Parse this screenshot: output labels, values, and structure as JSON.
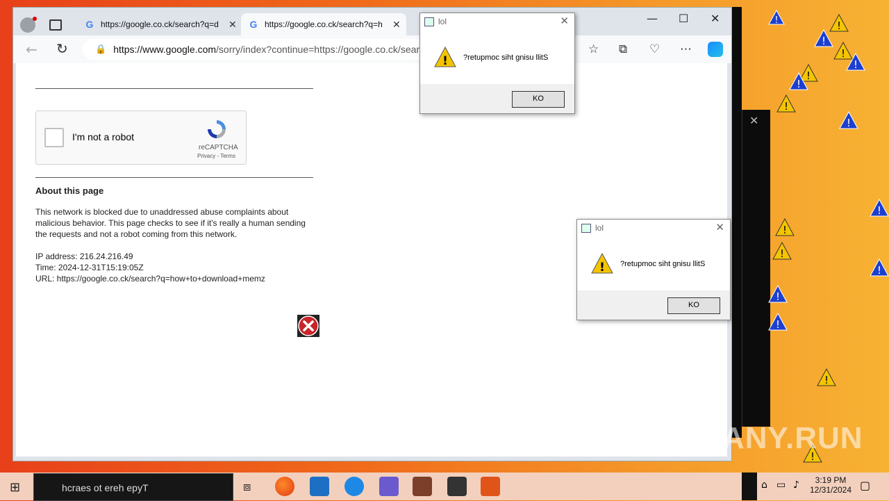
{
  "browser": {
    "tabs": [
      {
        "label": "https://google.co.ck/search?q=d"
      },
      {
        "label": "https://google.co.ck/search?q=h"
      }
    ],
    "address": {
      "host": "https://www.google.com",
      "path": "/sorry/index?continue=https://google.co.ck/sear"
    }
  },
  "page": {
    "recaptcha": {
      "label": "I'm not a robot",
      "brand": "reCAPTCHA",
      "terms": "Privacy - Terms"
    },
    "about_title": "About this page",
    "paragraph": "This network is blocked due to unaddressed abuse complaints about malicious behavior. This page checks to see if it's really a human sending the requests and not a robot coming from this network.",
    "ip": "IP address: 216.24.216.49",
    "time": "Time: 2024-12-31T15:19:05Z",
    "url": "URL: https://google.co.ck/search?q=how+to+download+memz"
  },
  "dialogs": [
    {
      "title": "lol",
      "message": "?retupmoc siht gnisu llitS",
      "button": "KO"
    },
    {
      "title": "lol",
      "message": "?retupmoc siht gnisu llitS",
      "button": "KO"
    }
  ],
  "taskbar": {
    "search_text": "hcraes ot ereh epyT",
    "time": "3:19 PM",
    "date": "12/31/2024"
  },
  "watermark": "ANY.RUN",
  "colors": {
    "accent": "#1a73e8",
    "warning": "#f5c400",
    "desktop": "#f06a1a"
  }
}
